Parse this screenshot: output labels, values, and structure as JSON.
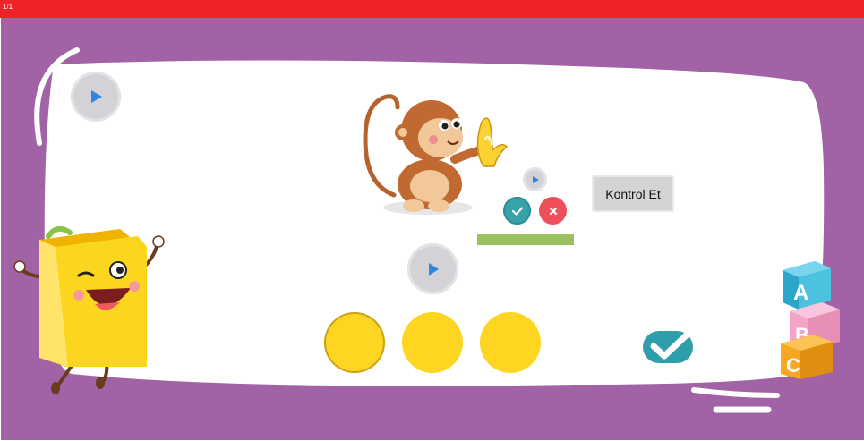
{
  "top_bar": {
    "page_indicator": "1/1",
    "color": "#ee2328"
  },
  "background_color": "#a163a6",
  "activity": {
    "check_button_label": "Kontrol Et",
    "answer_bar_color": "#9bc060",
    "choices": [
      {
        "color": "#fed520",
        "selected": true
      },
      {
        "color": "#fed520",
        "selected": false
      },
      {
        "color": "#fed520",
        "selected": false
      }
    ]
  },
  "decorations": {
    "blocks": [
      "A",
      "B",
      "C"
    ],
    "block_colors": [
      "#4cc2e0",
      "#f3a4c8",
      "#f7a823"
    ]
  },
  "icons": {
    "play": "play-icon",
    "check": "check-icon",
    "close": "close-icon",
    "monkey": "monkey-with-banana-illustration",
    "book": "book-mascot-illustration",
    "abc_blocks": "abc-blocks-illustration"
  }
}
